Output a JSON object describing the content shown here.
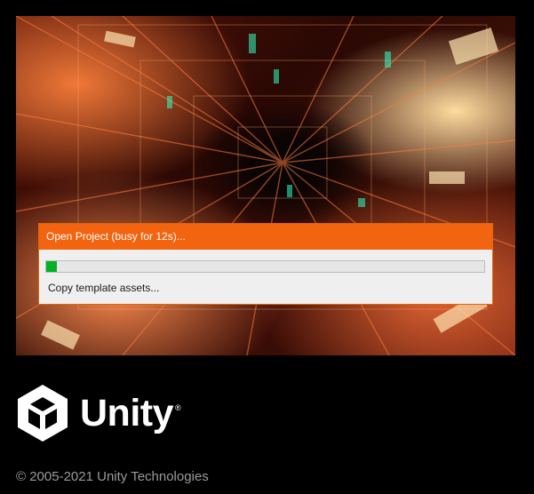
{
  "splash": {
    "image": "abstract-neon-corridor-artwork"
  },
  "dialog": {
    "title": "Open Project (busy for 12s)...",
    "progress_fraction": 0.024,
    "status": "Copy template assets...",
    "title_color": "#f2640f",
    "progress_color": "#06b025"
  },
  "branding": {
    "logo_icon": "unity-cube-icon",
    "wordmark": "Unity",
    "registered": "®",
    "copyright": "© 2005-2021 Unity Technologies"
  }
}
